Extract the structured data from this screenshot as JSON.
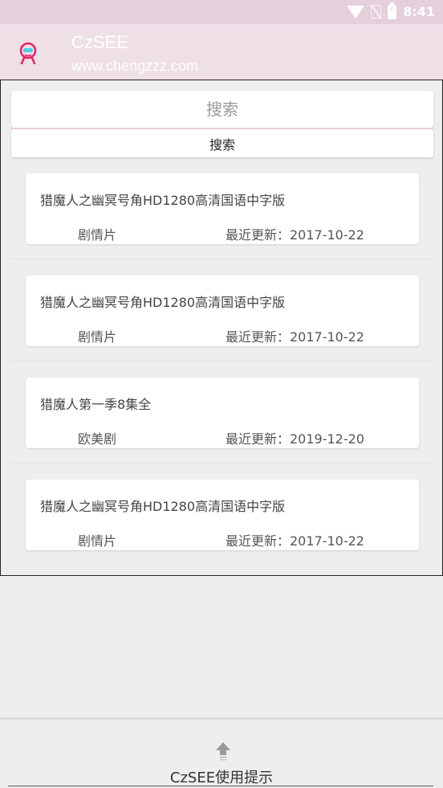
{
  "status_bar": {
    "time": "8:41"
  },
  "app_bar": {
    "title": "CzSEE",
    "subtitle": "www.chengzzz.com",
    "logo_icon": "robot-face-icon",
    "accent": "#e91e63"
  },
  "search": {
    "placeholder": "搜索",
    "button_label": "搜索"
  },
  "results": [
    {
      "title": "猎魔人之幽冥号角HD1280高清国语中字版",
      "category": "剧情片",
      "updated": "最近更新：2017-10-22"
    },
    {
      "title": "猎魔人之幽冥号角HD1280高清国语中字版",
      "category": "剧情片",
      "updated": "最近更新：2017-10-22"
    },
    {
      "title": "猎魔人第一季8集全",
      "category": "欧美剧",
      "updated": "最近更新：2019-12-20"
    },
    {
      "title": "猎魔人之幽冥号角HD1280高清国语中字版",
      "category": "剧情片",
      "updated": "最近更新：2017-10-22"
    }
  ],
  "bottom_sheet": {
    "label": "CzSEE使用提示",
    "icon": "up-arrow-icon"
  }
}
